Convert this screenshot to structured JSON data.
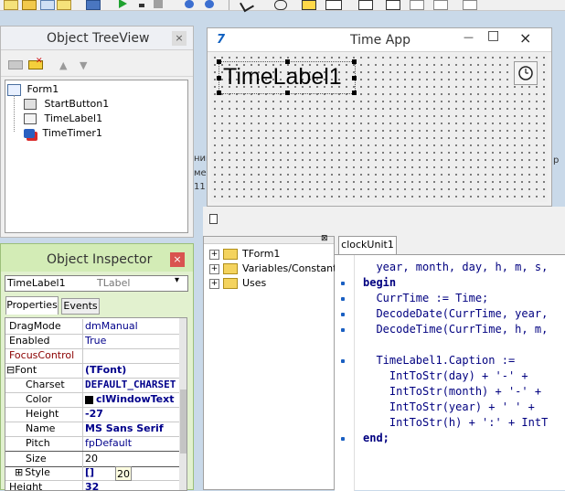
{
  "treeview": {
    "title": "Object TreeView",
    "close": "×",
    "items": [
      "Form1",
      "StartButton1",
      "TimeLabel1",
      "TimeTimer1"
    ]
  },
  "form": {
    "title": "Time App",
    "label_caption": "TimeLabel1",
    "minimize": "—",
    "maximize": "□",
    "close": "×"
  },
  "background_text": [
    "ниг",
    "ме",
    "11",
    "р"
  ],
  "inspector": {
    "title": "Object Inspector",
    "close": "×",
    "component_name": "TimeLabel1",
    "component_type": "TLabel",
    "tabs": [
      "Properties",
      "Events"
    ],
    "rows": [
      {
        "name": "DragMode",
        "value": "dmManual"
      },
      {
        "name": "Enabled",
        "value": "True"
      },
      {
        "name": "FocusControl",
        "value": ""
      },
      {
        "name": "Font",
        "value": "(TFont)"
      },
      {
        "name": "Charset",
        "value": "DEFAULT_CHARSET"
      },
      {
        "name": "Color",
        "value": "clWindowText"
      },
      {
        "name": "Height",
        "value": "-27"
      },
      {
        "name": "Name",
        "value": "MS Sans Serif"
      },
      {
        "name": "Pitch",
        "value": "fpDefault"
      },
      {
        "name": "Size",
        "value": "20"
      },
      {
        "name": "Style",
        "value": "[]"
      },
      {
        "name": "Height",
        "value": "32"
      }
    ],
    "tooltip": "20"
  },
  "code_explorer": {
    "items": [
      "TForm1",
      "Variables/Constants",
      "Uses"
    ]
  },
  "editor": {
    "tab": "clockUnit1",
    "lines": [
      "  year, month, day, h, m, s,",
      "begin",
      "  CurrTime := Time;",
      "  DecodeDate(CurrTime, year,",
      "  DecodeTime(CurrTime, h, m,",
      "",
      "  TimeLabel1.Caption :=",
      "    IntToStr(day) + '-' +",
      "    IntToStr(month) + '-' +",
      "    IntToStr(year) + ' ' +",
      "    IntToStr(h) + ':' + IntT",
      "end;"
    ]
  }
}
